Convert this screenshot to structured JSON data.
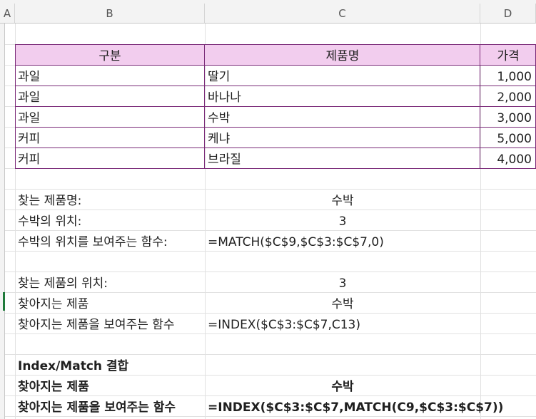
{
  "columns": [
    "A",
    "B",
    "C",
    "D"
  ],
  "table": {
    "headers": [
      "구분",
      "제품명",
      "가격"
    ],
    "rows": [
      [
        "과일",
        "딸기",
        "1,000"
      ],
      [
        "과일",
        "바나나",
        "2,000"
      ],
      [
        "과일",
        "수박",
        "3,000"
      ],
      [
        "커피",
        "케냐",
        "5,000"
      ],
      [
        "커피",
        "브라질",
        "4,000"
      ]
    ]
  },
  "match_section": {
    "label1": "찾는 제품명:",
    "value1": "수박",
    "label2": "수박의 위치:",
    "value2": "3",
    "label3": "수박의 위치를 보여주는 함수:",
    "value3": "=MATCH($C$9,$C$3:$C$7,0)"
  },
  "index_section": {
    "label1": "찾는 제품의 위치:",
    "value1": "3",
    "label2": "찾아지는 제품",
    "value2": "수박",
    "label3": "찾아지는 제품을 보여주는 함수",
    "value3": "=INDEX($C$3:$C$7,C13)"
  },
  "combined_section": {
    "title": "Index/Match 결합",
    "label1": "찾아지는 제품",
    "value1": "수박",
    "label2": "찾아지는 제품을 보여주는 함수",
    "value2": "=INDEX($C$3:$C$7,MATCH(C9,$C$3:$C$7))"
  },
  "colors": {
    "header_fill": "#f2cdee",
    "table_border": "#7a2a78",
    "selection": "#1f7a3a"
  }
}
